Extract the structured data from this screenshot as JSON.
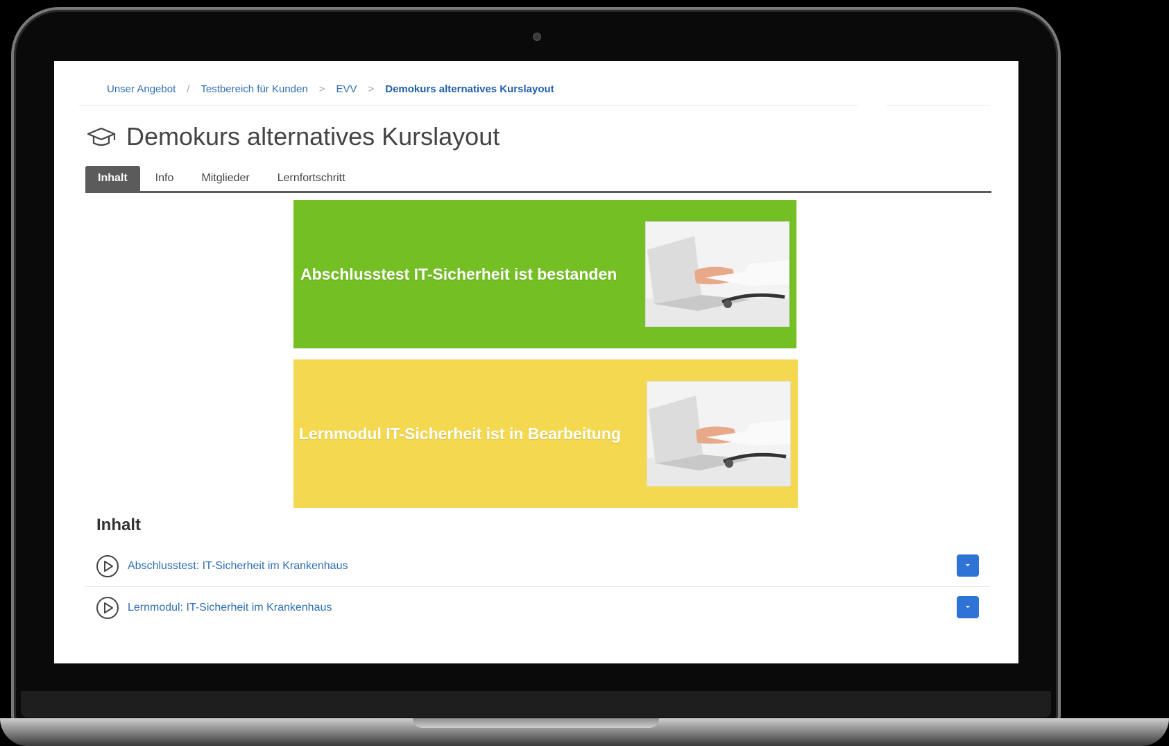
{
  "breadcrumb": {
    "items": [
      "Unser Angebot",
      "Testbereich für Kunden",
      "EVV"
    ],
    "current": "Demokurs alternatives Kurslayout"
  },
  "page": {
    "title": "Demokurs alternatives Kurslayout",
    "title_icon": "graduation-cap-icon"
  },
  "tabs": [
    {
      "label": "Inhalt",
      "active": true
    },
    {
      "label": "Info",
      "active": false
    },
    {
      "label": "Mitglieder",
      "active": false
    },
    {
      "label": "Lernfortschritt",
      "active": false
    }
  ],
  "banners": [
    {
      "text": "Abschlusstest IT-Sicherheit ist bestanden",
      "color": "#74bf24"
    },
    {
      "text": "Lernmodul IT-Sicherheit ist in Bearbeitung",
      "color": "#f4d84f"
    }
  ],
  "content": {
    "title": "Inhalt",
    "items": [
      {
        "label": "Abschlusstest: IT-Sicherheit im Krankenhaus",
        "icon": "play-circle-icon"
      },
      {
        "label": "Lernmodul: IT-Sicherheit im Krankenhaus",
        "icon": "play-circle-icon"
      }
    ]
  },
  "colors": {
    "link": "#2f6fb2",
    "dropdown_button": "#2f73d6",
    "active_tab": "#5b5b5b"
  }
}
